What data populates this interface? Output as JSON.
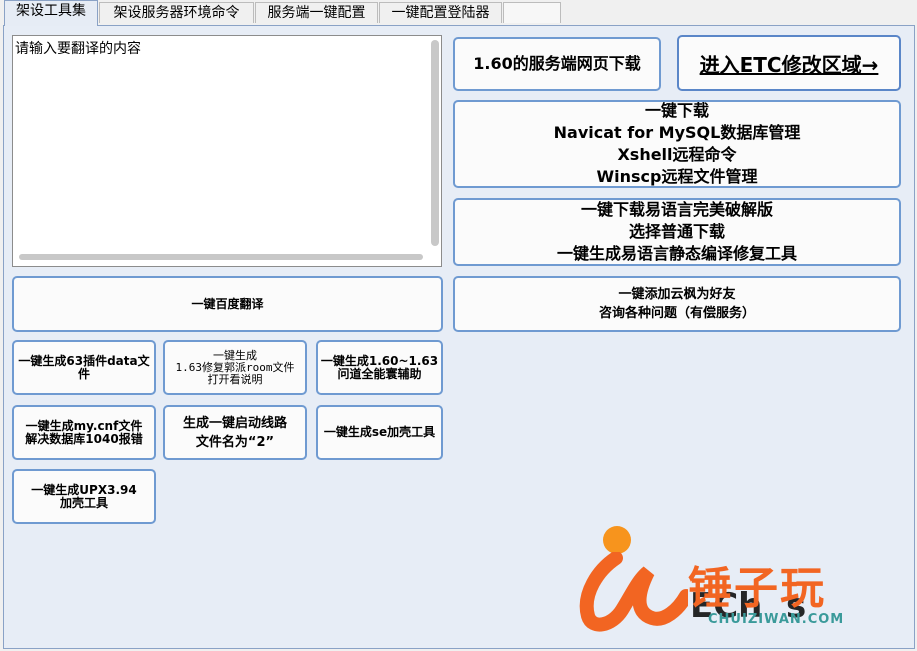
{
  "tabs": [
    {
      "label": "架设工具集",
      "active": true
    },
    {
      "label": "架设服务器环境命令",
      "active": false
    },
    {
      "label": "服务端一键配置",
      "active": false
    },
    {
      "label": "一键配置登陆器",
      "active": false
    }
  ],
  "translate": {
    "placeholder": "请输入要翻译的内容",
    "button": "一键百度翻译"
  },
  "right_buttons": {
    "download_web": "1.60的服务端网页下载",
    "etc_link": "进入ETC修改区域→",
    "navicat": [
      "一键下载",
      "Navicat for MySQL数据库管理",
      "Xshell远程命令",
      "Winscp远程文件管理"
    ],
    "easylang": [
      "一键下载易语言完美破解版",
      "选择普通下载",
      "一键生成易语言静态编译修复工具"
    ],
    "friend": [
      "一键添加云枫为好友",
      "咨询各种问题（有偿服务）"
    ]
  },
  "tool_buttons": {
    "gen63": "一键生成63插件data文件",
    "room": [
      "一键生成",
      "1.63修复郭派room文件",
      "打开看说明"
    ],
    "gen160": "一键生成1.60~1.63问道全能寰辅助",
    "mycnf": [
      "一键生成my.cnf文件",
      "解决数据库1040报错"
    ],
    "route": [
      "生成一键启动线路",
      "文件名为“2”"
    ],
    "se": "一键生成se加壳工具",
    "upx": [
      "一键生成UPX3.94",
      "加壳工具"
    ]
  },
  "watermark": {
    "cn_text": "锤子玩",
    "url": "CHUIZIWAN.COM",
    "brand_color": "#f26522",
    "dot_color": "#f7941d"
  },
  "colors": {
    "button_border": "#6f9ad1",
    "panel_bg": "#e7edf6"
  }
}
